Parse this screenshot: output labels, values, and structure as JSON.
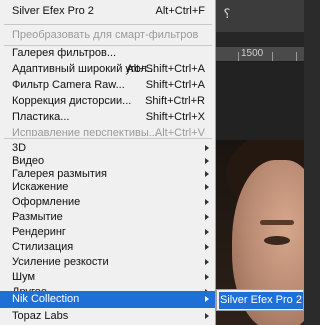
{
  "menu": {
    "last_filter": {
      "label": "Silver Efex Pro 2",
      "shortcut": "Alt+Ctrl+F"
    },
    "convert_smart": {
      "label": "Преобразовать для смарт-фильтров"
    },
    "filter_gallery": {
      "label": "Галерея фильтров..."
    },
    "adaptive_wide": {
      "label": "Адаптивный широкий угол...",
      "shortcut": "Alt+Shift+Ctrl+A"
    },
    "camera_raw": {
      "label": "Фильтр Camera Raw...",
      "shortcut": "Shift+Ctrl+A"
    },
    "lens_correction": {
      "label": "Коррекция дисторсии...",
      "shortcut": "Shift+Ctrl+R"
    },
    "liquify": {
      "label": "Пластика...",
      "shortcut": "Shift+Ctrl+X"
    },
    "perspective": {
      "label": "Исправление перспективы...",
      "shortcut": "Alt+Ctrl+V"
    },
    "submenus": [
      "3D",
      "Видео",
      "Галерея размытия",
      "Искажение",
      "Оформление",
      "Размытие",
      "Рендеринг",
      "Стилизация",
      "Усиление резкости",
      "Шум",
      "Другое"
    ],
    "nik_collection": {
      "label": "Nik Collection"
    },
    "topaz_labs": {
      "label": "Topaz Labs"
    }
  },
  "submenu": {
    "silver_efex": {
      "label": "Silver Efex Pro 2"
    }
  },
  "ruler": {
    "label": "1500"
  },
  "toolbar": {
    "icon": "refine-brush-icon"
  },
  "colors": {
    "highlight": "#1e6fd6",
    "menu_bg": "#f0f0f0",
    "disabled_text": "#9a9a9a"
  }
}
